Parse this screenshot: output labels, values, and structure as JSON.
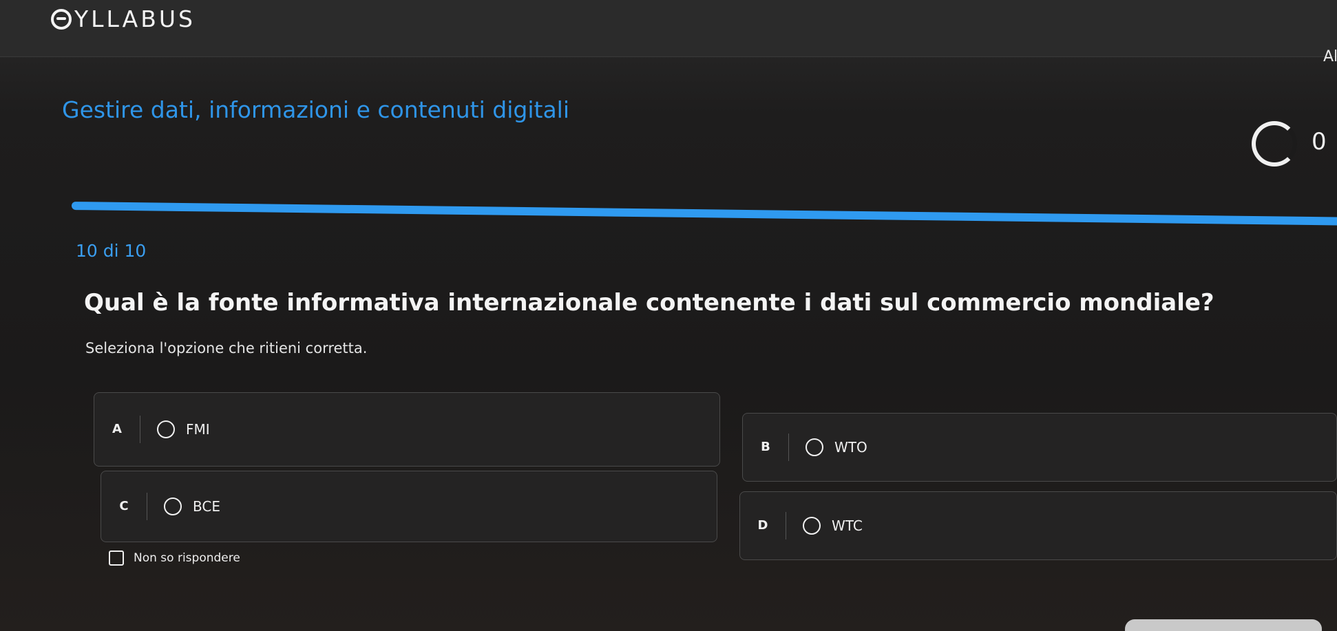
{
  "app": {
    "logo_text": "YLLABUS",
    "user_initials": "Al"
  },
  "quiz": {
    "section_title": "Gestire dati, informazioni e contenuti digitali",
    "timer_value": "0",
    "progress_fraction": 1.0,
    "counter": "10 di 10",
    "question": "Qual è la fonte informativa internazionale contenente i dati sul commercio mondiale?",
    "instruction": "Seleziona l'opzione che ritieni corretta.",
    "options": [
      {
        "letter": "A",
        "label": "FMI"
      },
      {
        "letter": "B",
        "label": "WTO"
      },
      {
        "letter": "C",
        "label": "BCE"
      },
      {
        "letter": "D",
        "label": "WTC"
      }
    ],
    "dont_know_label": "Non so rispondere"
  },
  "colors": {
    "accent": "#2f95e8",
    "background": "#1c1b1b",
    "text": "#f2f2f2"
  }
}
